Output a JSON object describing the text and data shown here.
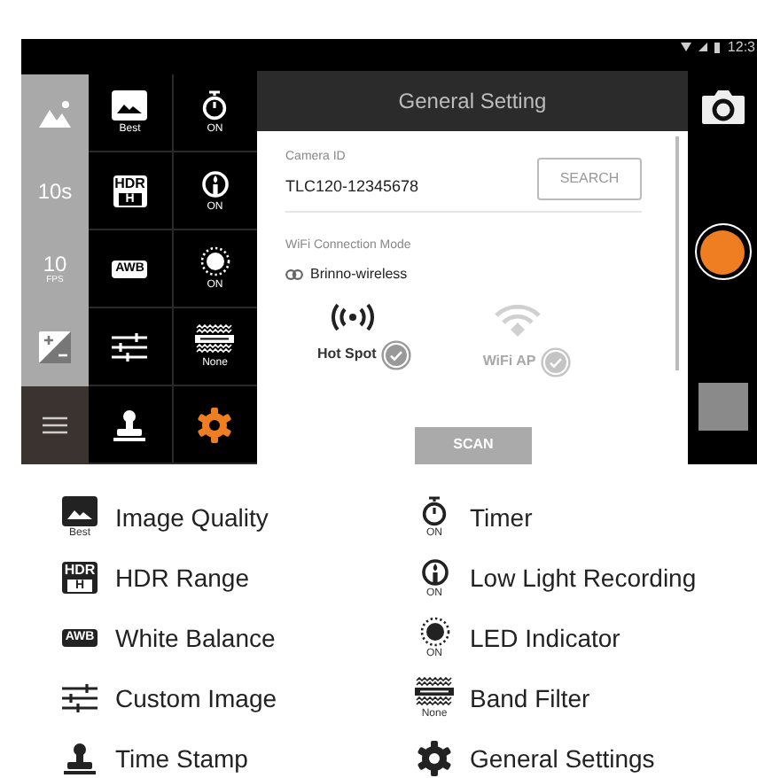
{
  "status_bar": {
    "time": "12:3"
  },
  "left_rail": {
    "items": [
      {
        "kind": "mountain"
      },
      {
        "kind": "text",
        "text": "10s"
      },
      {
        "kind": "text",
        "text": "10",
        "sub": "FPS"
      },
      {
        "kind": "exposure"
      }
    ]
  },
  "settings_grid": [
    {
      "kind": "image",
      "caption": "Best",
      "selected": false
    },
    {
      "kind": "timer",
      "caption": "ON",
      "selected": false
    },
    {
      "kind": "hdr",
      "icon_text": [
        "HDR",
        "H"
      ],
      "selected": false
    },
    {
      "kind": "lowlight",
      "caption": "ON",
      "selected": false
    },
    {
      "kind": "awb",
      "icon_text": [
        "AWB"
      ],
      "selected": false
    },
    {
      "kind": "led",
      "caption": "ON",
      "selected": false
    },
    {
      "kind": "sliders",
      "selected": false
    },
    {
      "kind": "band",
      "caption": "None",
      "selected": false
    },
    {
      "kind": "stamp",
      "selected": false
    },
    {
      "kind": "gear",
      "selected": true
    }
  ],
  "dialog": {
    "title": "General Setting",
    "camera_id_label": "Camera ID",
    "camera_id": "TLC120-12345678",
    "search_button": "SEARCH",
    "wifi_label": "WiFi Connection Mode",
    "wifi_network": "Brinno-wireless",
    "modes": [
      {
        "kind": "hotspot",
        "label": "Hot Spot",
        "selected": true
      },
      {
        "kind": "wifi",
        "label": "WiFi AP",
        "selected": false
      }
    ],
    "scan_button": "SCAN"
  },
  "legend": {
    "columns": [
      [
        {
          "kind": "image",
          "caption": "Best",
          "label": "Image Quality"
        },
        {
          "kind": "hdr",
          "icon_text": [
            "HDR",
            "H"
          ],
          "label": "HDR Range"
        },
        {
          "kind": "awb",
          "icon_text": [
            "AWB"
          ],
          "label": "White Balance"
        },
        {
          "kind": "sliders",
          "label": "Custom Image"
        },
        {
          "kind": "stamp",
          "label": "Time Stamp"
        }
      ],
      [
        {
          "kind": "timer",
          "caption": "ON",
          "label": "Timer"
        },
        {
          "kind": "lowlight",
          "caption": "ON",
          "label": "Low Light Recording"
        },
        {
          "kind": "led",
          "caption": "ON",
          "label": "LED Indicator"
        },
        {
          "kind": "band",
          "caption": "None",
          "label": "Band Filter"
        },
        {
          "kind": "gear",
          "label": "General Settings"
        }
      ]
    ]
  }
}
